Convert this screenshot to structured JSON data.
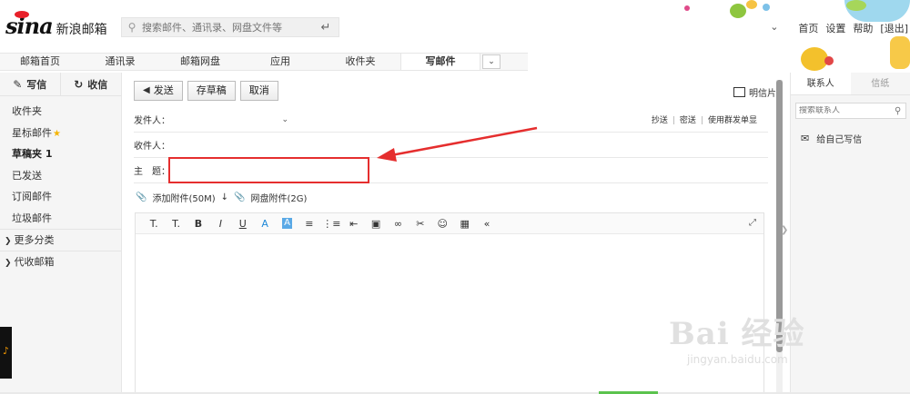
{
  "brand": {
    "logo": "sina",
    "name": "新浪邮箱"
  },
  "search": {
    "placeholder": "搜索邮件、通讯录、网盘文件等"
  },
  "top_links": [
    "首页",
    "设置",
    "帮助",
    "[退出]"
  ],
  "nav": {
    "tabs": [
      "邮箱首页",
      "通讯录",
      "邮箱网盘",
      "应用",
      "收件夹",
      "写邮件"
    ],
    "active": "写邮件"
  },
  "sidebar": {
    "write_label": "写信",
    "receive_label": "收信",
    "folders": [
      {
        "label": "收件夹"
      },
      {
        "label": "星标邮件"
      },
      {
        "label": "草稿夹 1"
      },
      {
        "label": "已发送"
      },
      {
        "label": "订阅邮件"
      },
      {
        "label": "垃圾邮件"
      }
    ],
    "more_label": "更多分类",
    "proxy_label": "代收邮箱"
  },
  "compose": {
    "send_label": "发送",
    "draft_label": "存草稿",
    "cancel_label": "取消",
    "postcard_label": "明信片",
    "sender_label": "发件人：",
    "cc_label": "抄送",
    "bcc_label": "密送",
    "group_single_label": "使用群发单显",
    "to_label": "收件人：",
    "subject_label": "主　题：",
    "attach_label": "添加附件(50M)",
    "disk_attach_label": "网盘附件(2G)"
  },
  "right_panel": {
    "tabs": [
      "联系人",
      "信纸"
    ],
    "search_placeholder": "搜索联系人",
    "self_label": "给自己写信"
  },
  "watermark": {
    "main": "Bai 经验",
    "sub": "jingyan.baidu.com"
  },
  "colors": {
    "highlight": "#e52e2e",
    "accent_blue": "#1e88d8",
    "star": "#f5b400"
  }
}
